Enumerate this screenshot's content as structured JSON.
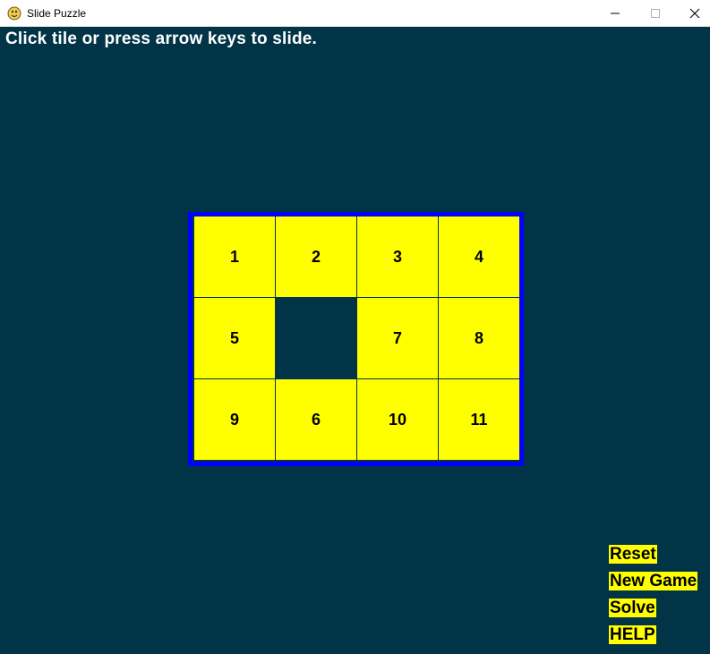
{
  "window": {
    "title": "Slide Puzzle",
    "icon": "pygame-snake-icon",
    "controls": [
      "minimize-icon",
      "maximize-icon",
      "close-icon"
    ]
  },
  "message": "Click tile or press arrow keys to slide.",
  "board": {
    "columns": 4,
    "rows": 3,
    "tiles": [
      [
        "1",
        "2",
        "3",
        "4"
      ],
      [
        "5",
        "",
        "7",
        "8"
      ],
      [
        "9",
        "6",
        "10",
        "11"
      ]
    ],
    "colors": {
      "background": "#003446",
      "tile": "#ffff00",
      "border": "#0000ff",
      "tile_text": "#000000",
      "message_text": "#ffffff"
    }
  },
  "buttons": {
    "reset": "Reset",
    "new_game": "New Game",
    "solve": "Solve",
    "help": "HELP"
  }
}
